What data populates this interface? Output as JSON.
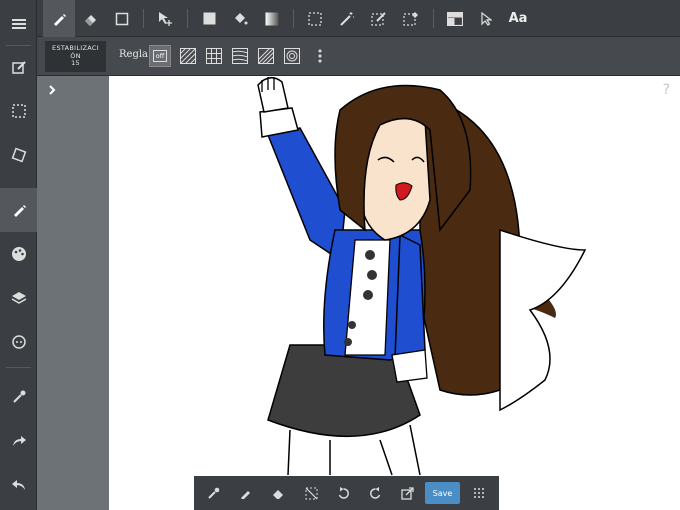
{
  "top_toolbar": {
    "tools": [
      "pen-icon",
      "eraser-icon",
      "shape-rect-icon",
      "move-icon",
      "fill-rect-icon",
      "bucket-icon",
      "gradient-icon",
      "select-rect-icon",
      "magic-wand-icon",
      "select-pen-icon",
      "select-erase-icon",
      "layout-icon",
      "pointer-icon",
      "text-icon"
    ],
    "text_label": "Aa"
  },
  "sub_toolbar": {
    "stabilizer_line1": "ESTABILIZACI",
    "stabilizer_line2": "ÓN",
    "stabilizer_value": "15",
    "ruler_label": "Regla",
    "ruler_off_label": "off"
  },
  "left_rail": {
    "items": [
      "menu-icon",
      "edit-icon",
      "select-icon",
      "transform-icon",
      "pen-icon",
      "palette-icon",
      "layers-icon",
      "material-icon",
      "eyedropper-icon",
      "redo-icon",
      "undo-icon"
    ]
  },
  "canvas": {
    "help_label": "?"
  },
  "bottom_bar": {
    "tools": [
      "eyedropper-icon",
      "pen-icon",
      "eraser-icon",
      "deselect-icon",
      "undo-icon",
      "redo-icon",
      "export-icon",
      "grid-icon"
    ],
    "save_label": "Save"
  },
  "colors": {
    "toolbar": "#3b3e42",
    "subbar": "#46494d",
    "strip": "#6d7277",
    "canvas": "#ffffff",
    "save": "#4b8dc5",
    "jacket": "#1f4fd0",
    "hair": "#4a2a10",
    "skirt": "#3d3d3d"
  }
}
